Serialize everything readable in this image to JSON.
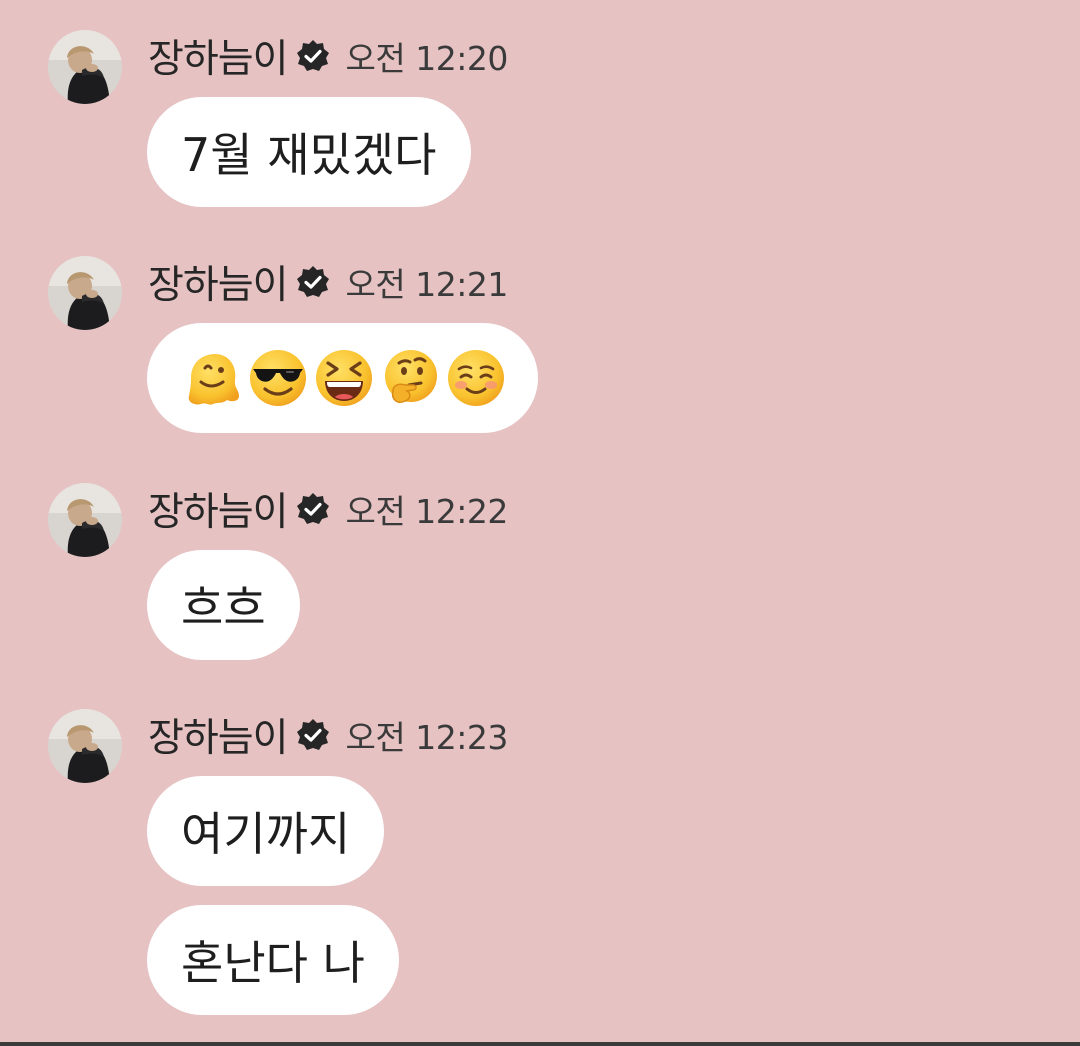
{
  "colors": {
    "background": "#e6c2c3",
    "bubble": "#ffffff",
    "text": "#1e1e1e",
    "verified_badge": "#262626"
  },
  "messages": [
    {
      "sender": "장하늠이",
      "verified": true,
      "time": "오전 12:20",
      "bubbles": [
        {
          "text": "7월 재밌겠다"
        }
      ]
    },
    {
      "sender": "장하늠이",
      "verified": true,
      "time": "오전 12:21",
      "bubbles": [
        {
          "emoji": [
            "melting-face",
            "smiling-face-with-sunglasses",
            "grinning-squinting-face",
            "thinking-face",
            "smiling-face"
          ]
        }
      ]
    },
    {
      "sender": "장하늠이",
      "verified": true,
      "time": "오전 12:22",
      "bubbles": [
        {
          "text": "흐흐"
        }
      ]
    },
    {
      "sender": "장하늠이",
      "verified": true,
      "time": "오전 12:23",
      "bubbles": [
        {
          "text": "여기까지"
        },
        {
          "text": "혼난다 나"
        }
      ]
    }
  ]
}
